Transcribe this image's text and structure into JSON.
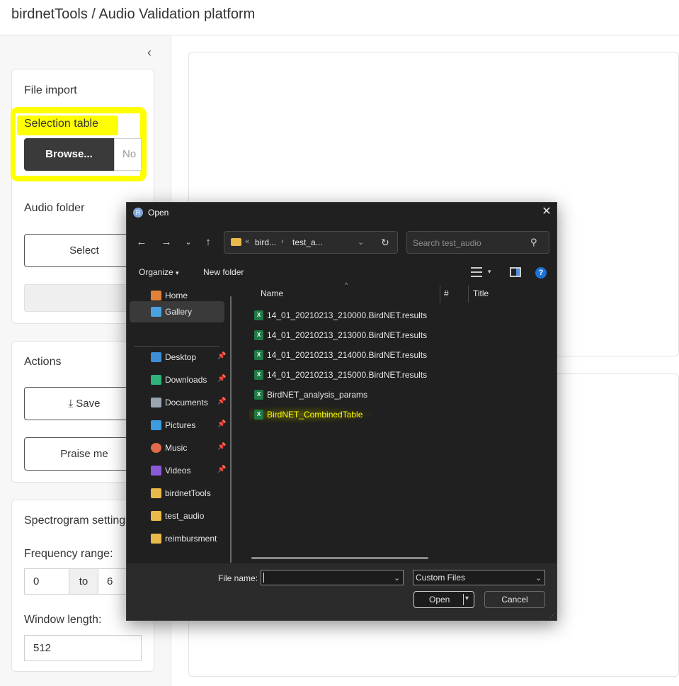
{
  "app": {
    "title": "birdnetTools / Audio Validation platform"
  },
  "sidebar": {
    "collapse_icon": "chevron-left-icon",
    "file_import": {
      "title": "File import",
      "selection_table_label": "Selection table",
      "browse_label": "Browse...",
      "file_placeholder": "No",
      "audio_folder_label": "Audio folder",
      "select_label": "Select"
    },
    "actions": {
      "title": "Actions",
      "save_label": "Save",
      "praise_label": "Praise me"
    },
    "spectrogram": {
      "title": "Spectrogram settings",
      "frequency_label": "Frequency range:",
      "freq_min": "0",
      "to_label": "to",
      "freq_max": "6",
      "window_label": "Window length:",
      "window_value": "512"
    },
    "highlight_color": "#ffff00"
  },
  "dialog": {
    "title": "Open",
    "app_icon_letter": "R",
    "address": {
      "prefix": "«",
      "segment1": "bird...",
      "segment2": "test_a..."
    },
    "search_placeholder": "Search test_audio",
    "toolbar": {
      "organize": "Organize",
      "new_folder": "New folder"
    },
    "nav_items": [
      {
        "label": "Home",
        "icon": "home-icon",
        "color": "#e0823a",
        "pinned": false
      },
      {
        "label": "Gallery",
        "icon": "gallery-icon",
        "color": "#4aa3e0",
        "pinned": false
      },
      {
        "label": "Desktop",
        "icon": "desktop-icon",
        "color": "#3c8fd6",
        "pinned": true
      },
      {
        "label": "Downloads",
        "icon": "downloads-icon",
        "color": "#2fb37a",
        "pinned": true
      },
      {
        "label": "Documents",
        "icon": "documents-icon",
        "color": "#9aa4b0",
        "pinned": true
      },
      {
        "label": "Pictures",
        "icon": "pictures-icon",
        "color": "#3d9be0",
        "pinned": true
      },
      {
        "label": "Music",
        "icon": "music-icon",
        "color": "#e06a4a",
        "pinned": true
      },
      {
        "label": "Videos",
        "icon": "videos-icon",
        "color": "#8a5ad6",
        "pinned": true
      },
      {
        "label": "birdnetTools",
        "icon": "folder-icon",
        "color": "#e9b94b",
        "pinned": false
      },
      {
        "label": "test_audio",
        "icon": "folder-icon",
        "color": "#e9b94b",
        "pinned": false
      },
      {
        "label": "reimbursment",
        "icon": "folder-icon",
        "color": "#e9b94b",
        "pinned": false
      }
    ],
    "columns": {
      "name": "Name",
      "number": "#",
      "title": "Title"
    },
    "files": [
      {
        "name": "14_01_20210213_210000.BirdNET.results",
        "highlighted": false
      },
      {
        "name": "14_01_20210213_213000.BirdNET.results",
        "highlighted": false
      },
      {
        "name": "14_01_20210213_214000.BirdNET.results",
        "highlighted": false
      },
      {
        "name": "14_01_20210213_215000.BirdNET.results",
        "highlighted": false
      },
      {
        "name": "BirdNET_analysis_params",
        "highlighted": false
      },
      {
        "name": "BirdNET_CombinedTable",
        "highlighted": true
      }
    ],
    "footer": {
      "file_name_label": "File name:",
      "file_name_value": "",
      "file_type": "Custom Files",
      "open_label": "Open",
      "cancel_label": "Cancel"
    }
  }
}
